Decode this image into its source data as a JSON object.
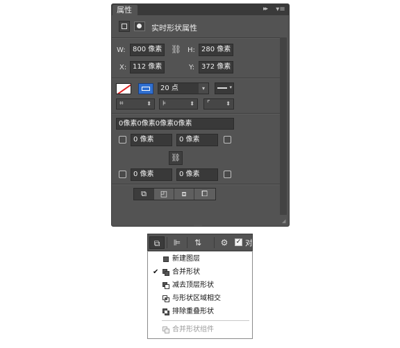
{
  "panel": {
    "tab_label": "属性",
    "tab_close": "×",
    "collapse_icon": "▸▸",
    "menu_icon": "▾≡",
    "header_title": "实时形状属性",
    "width_label": "W:",
    "width_value": "800 像素",
    "height_label": "H:",
    "height_value": "280 像素",
    "x_label": "X:",
    "x_value": "112 像素",
    "y_label": "Y:",
    "y_value": "372 像素",
    "stroke_size": "20 点",
    "radius_all": "0像素0像素0像素0像素",
    "radius_tl": "0 像素",
    "radius_tr": "0 像素",
    "radius_bl": "0 像素",
    "radius_br": "0 像素",
    "icons": [
      "shape-bounds-icon",
      "mask-icon",
      "link-icon",
      "stroke-color-icon",
      "fill-color-icon",
      "line-style-icon",
      "align-stroke-icon",
      "cap-type-icon",
      "corner-type-icon"
    ],
    "colors": {
      "stroke_slash": "#dd2222",
      "fill": "#2f6fd0",
      "panel_bg": "#535353"
    }
  },
  "toolbar": {
    "check_mark": "✓",
    "align_text": "对",
    "icons": [
      "path-operations-icon",
      "path-alignment-icon",
      "path-arrangement-icon",
      "gear-icon",
      "checkbox-icon"
    ]
  },
  "dropdown": {
    "items": [
      {
        "label": "新建图层",
        "checked": false,
        "disabled": false
      },
      {
        "label": "合并形状",
        "checked": true,
        "disabled": false
      },
      {
        "label": "减去顶层形状",
        "checked": false,
        "disabled": false
      },
      {
        "label": "与形状区域相交",
        "checked": false,
        "disabled": false
      },
      {
        "label": "排除重叠形状",
        "checked": false,
        "disabled": false
      },
      {
        "label": "合并形状组件",
        "checked": false,
        "disabled": true
      }
    ],
    "check_glyph": "✔"
  }
}
